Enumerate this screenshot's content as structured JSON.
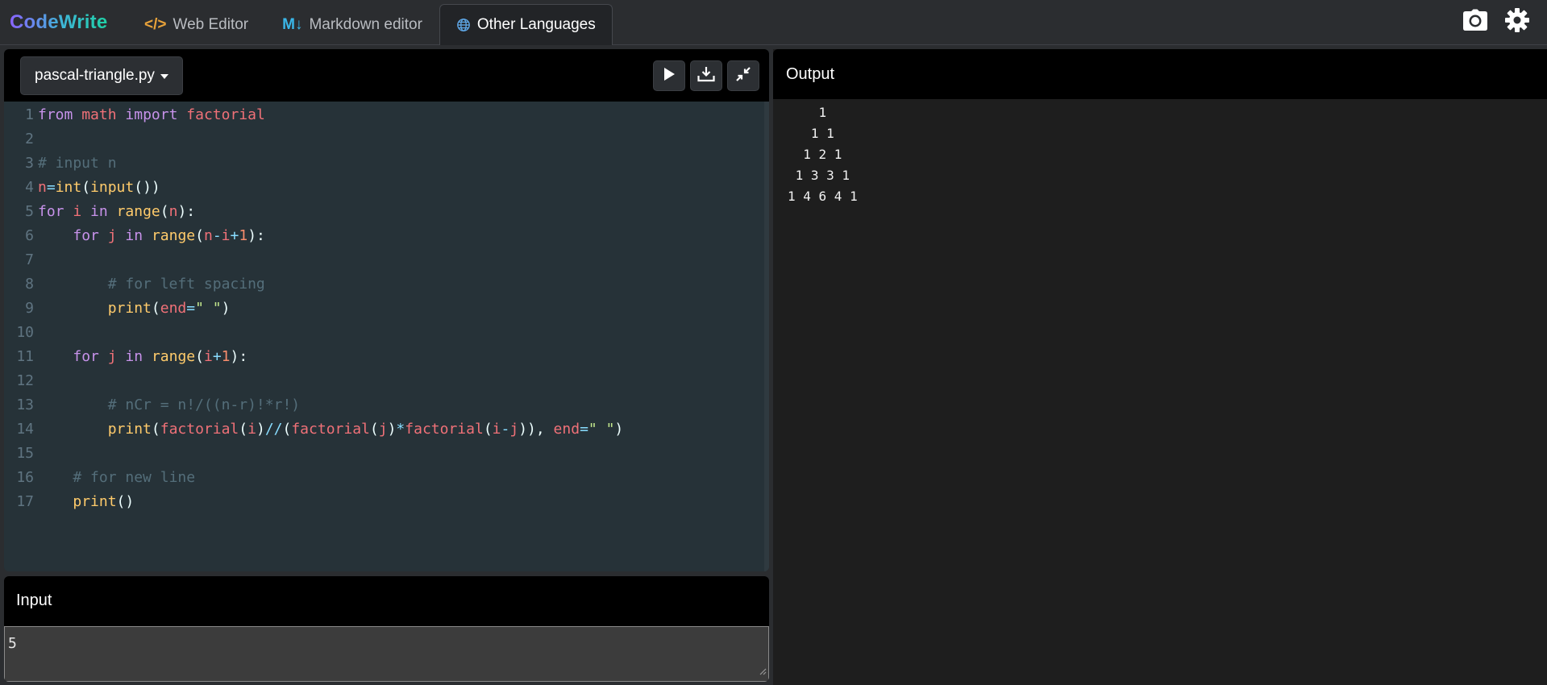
{
  "app": {
    "brand": "CodeWrite"
  },
  "nav": {
    "tabs": [
      {
        "icon_text": "</>",
        "label": "Web Editor",
        "active": false
      },
      {
        "icon_text": "M↓",
        "label": "Markdown editor",
        "active": false
      },
      {
        "icon": "globe-icon",
        "label": "Other Languages",
        "active": true
      }
    ],
    "actions": [
      {
        "icon": "camera-icon"
      },
      {
        "icon": "gear-icon"
      }
    ]
  },
  "editor": {
    "file_name": "pascal-triangle.py",
    "actions": [
      "play-icon",
      "download-icon",
      "collapse-icon"
    ],
    "lines": [
      {
        "n": "1",
        "tokens": [
          [
            "from",
            "kw"
          ],
          [
            " ",
            "p"
          ],
          [
            "math",
            "var"
          ],
          [
            " ",
            "p"
          ],
          [
            "import",
            "kw"
          ],
          [
            " ",
            "p"
          ],
          [
            "factorial",
            "var"
          ]
        ]
      },
      {
        "n": "2",
        "tokens": []
      },
      {
        "n": "3",
        "tokens": [
          [
            "# input n",
            "cm"
          ]
        ]
      },
      {
        "n": "4",
        "tokens": [
          [
            "n",
            "var"
          ],
          [
            "=",
            "op"
          ],
          [
            "int",
            "fn"
          ],
          [
            "(",
            "p"
          ],
          [
            "input",
            "fn"
          ],
          [
            "())",
            "p"
          ]
        ]
      },
      {
        "n": "5",
        "tokens": [
          [
            "for",
            "kw"
          ],
          [
            " ",
            "p"
          ],
          [
            "i",
            "var"
          ],
          [
            " ",
            "p"
          ],
          [
            "in",
            "kw"
          ],
          [
            " ",
            "p"
          ],
          [
            "range",
            "fn"
          ],
          [
            "(",
            "p"
          ],
          [
            "n",
            "var"
          ],
          [
            "):",
            "p"
          ]
        ]
      },
      {
        "n": "6",
        "tokens": [
          [
            "    ",
            "p"
          ],
          [
            "for",
            "kw"
          ],
          [
            " ",
            "p"
          ],
          [
            "j",
            "var"
          ],
          [
            " ",
            "p"
          ],
          [
            "in",
            "kw"
          ],
          [
            " ",
            "p"
          ],
          [
            "range",
            "fn"
          ],
          [
            "(",
            "p"
          ],
          [
            "n",
            "var"
          ],
          [
            "-",
            "op"
          ],
          [
            "i",
            "var"
          ],
          [
            "+",
            "op"
          ],
          [
            "1",
            "num"
          ],
          [
            "):",
            "p"
          ]
        ]
      },
      {
        "n": "7",
        "tokens": []
      },
      {
        "n": "8",
        "tokens": [
          [
            "        ",
            "p"
          ],
          [
            "# for left spacing",
            "cm"
          ]
        ]
      },
      {
        "n": "9",
        "tokens": [
          [
            "        ",
            "p"
          ],
          [
            "print",
            "fn"
          ],
          [
            "(",
            "p"
          ],
          [
            "end",
            "var"
          ],
          [
            "=",
            "op"
          ],
          [
            "\" \"",
            "str"
          ],
          [
            ")",
            "p"
          ]
        ]
      },
      {
        "n": "10",
        "tokens": []
      },
      {
        "n": "11",
        "tokens": [
          [
            "    ",
            "p"
          ],
          [
            "for",
            "kw"
          ],
          [
            " ",
            "p"
          ],
          [
            "j",
            "var"
          ],
          [
            " ",
            "p"
          ],
          [
            "in",
            "kw"
          ],
          [
            " ",
            "p"
          ],
          [
            "range",
            "fn"
          ],
          [
            "(",
            "p"
          ],
          [
            "i",
            "var"
          ],
          [
            "+",
            "op"
          ],
          [
            "1",
            "num"
          ],
          [
            "):",
            "p"
          ]
        ]
      },
      {
        "n": "12",
        "tokens": []
      },
      {
        "n": "13",
        "tokens": [
          [
            "        ",
            "p"
          ],
          [
            "# nCr = n!/((n-r)!*r!)",
            "cm"
          ]
        ]
      },
      {
        "n": "14",
        "tokens": [
          [
            "        ",
            "p"
          ],
          [
            "print",
            "fn"
          ],
          [
            "(",
            "p"
          ],
          [
            "factorial",
            "var"
          ],
          [
            "(",
            "p"
          ],
          [
            "i",
            "var"
          ],
          [
            ")",
            "p"
          ],
          [
            "//",
            "op"
          ],
          [
            "(",
            "p"
          ],
          [
            "factorial",
            "var"
          ],
          [
            "(",
            "p"
          ],
          [
            "j",
            "var"
          ],
          [
            ")",
            "p"
          ],
          [
            "*",
            "op"
          ],
          [
            "factorial",
            "var"
          ],
          [
            "(",
            "p"
          ],
          [
            "i",
            "var"
          ],
          [
            "-",
            "op"
          ],
          [
            "j",
            "var"
          ],
          [
            ")),",
            "p"
          ],
          [
            " ",
            "p"
          ],
          [
            "end",
            "var"
          ],
          [
            "=",
            "op"
          ],
          [
            "\" \"",
            "str"
          ],
          [
            ")",
            "p"
          ]
        ]
      },
      {
        "n": "15",
        "tokens": []
      },
      {
        "n": "16",
        "tokens": [
          [
            "    ",
            "p"
          ],
          [
            "# for new line",
            "cm"
          ]
        ]
      },
      {
        "n": "17",
        "tokens": [
          [
            "    ",
            "p"
          ],
          [
            "print",
            "fn"
          ],
          [
            "()",
            "p"
          ]
        ]
      }
    ]
  },
  "input": {
    "title": "Input",
    "value": "5"
  },
  "output": {
    "title": "Output",
    "text": "    1\n   1 1\n  1 2 1\n 1 3 3 1\n1 4 6 4 1"
  }
}
